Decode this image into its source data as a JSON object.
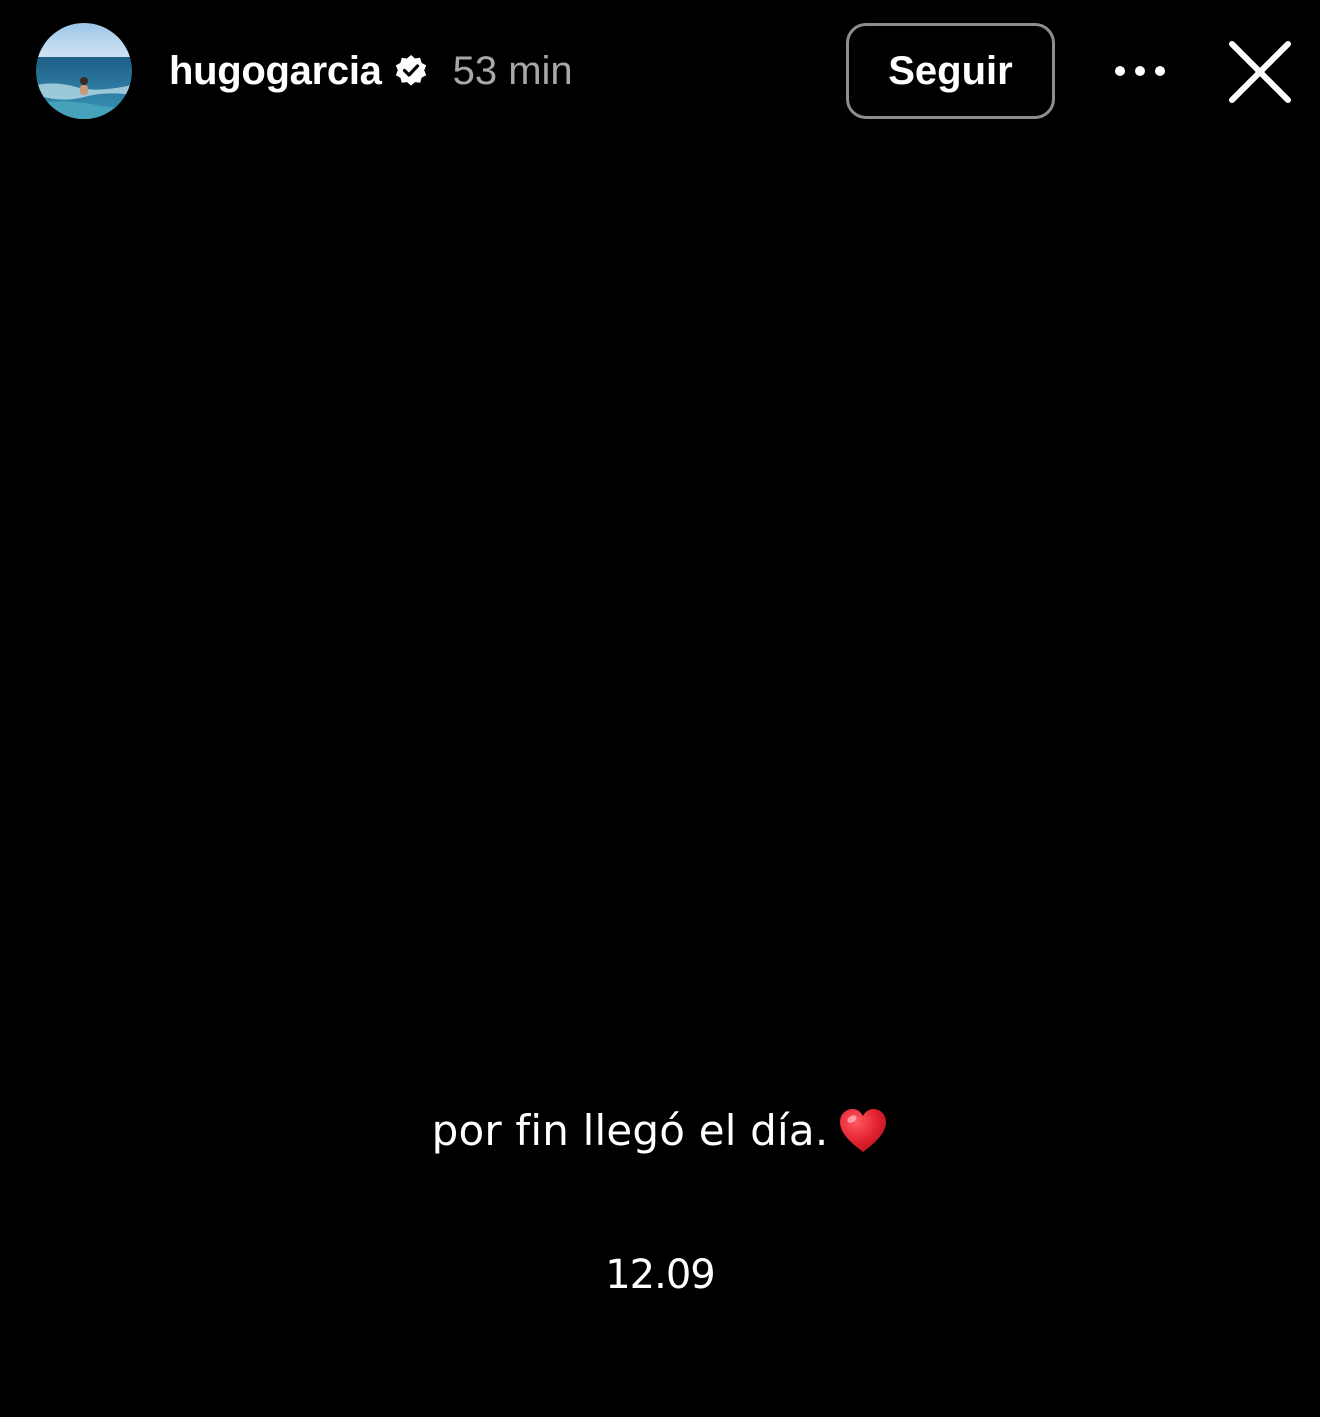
{
  "header": {
    "username": "hugogarcia",
    "verified_icon": "verified-badge-icon",
    "time_ago": "53 min",
    "follow_label": "Seguir",
    "more_icon": "more-options-icon",
    "close_icon": "close-icon"
  },
  "story": {
    "caption": "por fin llegó el día.",
    "caption_emoji_icon": "red-heart-icon",
    "date": "12.09"
  },
  "colors": {
    "background": "#000000",
    "text_primary": "#ffffff",
    "text_secondary": "#a8a8a8",
    "button_border": "#8e8e8e",
    "heart": "#e0202e"
  }
}
